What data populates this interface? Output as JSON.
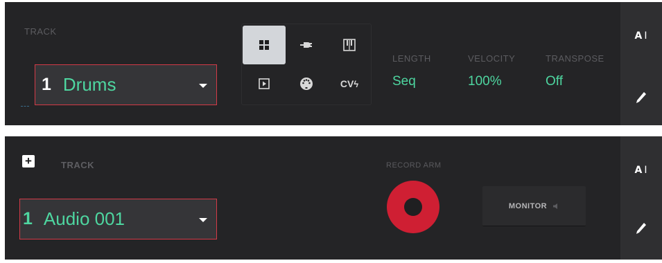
{
  "sequence_panel": {
    "track_label": "TRACK",
    "track_number": "1",
    "track_name": "Drums",
    "track_types": [
      "drum-program-icon",
      "plugin-icon",
      "keygroup-icon",
      "clip-icon",
      "midi-icon",
      "cv-icon"
    ],
    "active_type": "drum-program-icon",
    "cv_label": "CV",
    "params": [
      {
        "label": "LENGTH",
        "value": "Seq"
      },
      {
        "label": "VELOCITY",
        "value": "100%"
      },
      {
        "label": "TRANSPOSE",
        "value": "Off"
      }
    ],
    "rename_label": "A",
    "edit_icon": "pencil-icon"
  },
  "audio_panel": {
    "add_label": "+",
    "track_label": "TRACK",
    "track_number": "1",
    "track_name": "Audio 001",
    "record_arm_label": "RECORD ARM",
    "monitor_label": "MONITOR",
    "rename_label": "A",
    "edit_icon": "pencil-icon"
  },
  "colors": {
    "accent_green": "#4ed6a0",
    "select_border": "#d43a47",
    "record_red": "#cf1f33"
  }
}
